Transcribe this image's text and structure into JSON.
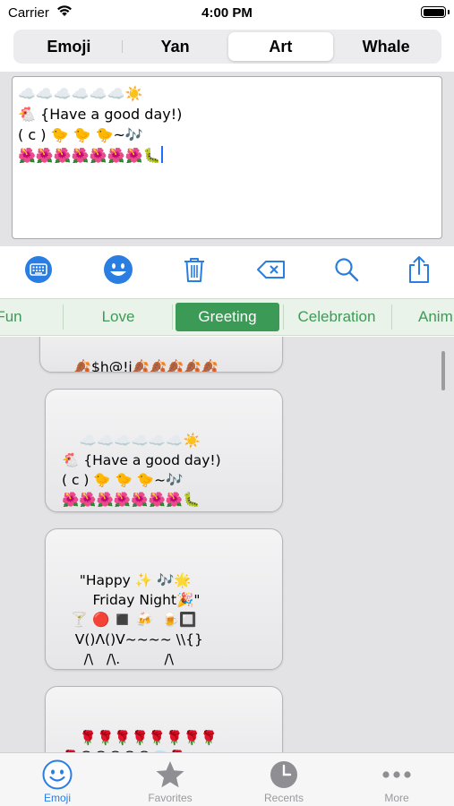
{
  "status_bar": {
    "carrier": "Carrier",
    "time": "4:00 PM"
  },
  "segments": [
    {
      "label": "Emoji"
    },
    {
      "label": "Yan"
    },
    {
      "label": "Art",
      "selected": true
    },
    {
      "label": "Whale"
    }
  ],
  "editor": {
    "text": "☁️☁️☁️☁️☁️☁️☀️\n🐔 {Have a good day!)\n( c ) 🐤 🐤 🐤~🎶\n🌺🌺🌺🌺🌺🌺🌺🐛"
  },
  "toolbar": {
    "icons": [
      "keyboard-icon",
      "smiley-icon",
      "trash-icon",
      "delete-backward-icon",
      "search-icon",
      "share-icon"
    ],
    "accent_color": "#2a7de1"
  },
  "categories": [
    {
      "label": "Fun"
    },
    {
      "label": "Love"
    },
    {
      "label": "Greeting",
      "selected": true
    },
    {
      "label": "Celebration"
    },
    {
      "label": "Anim"
    }
  ],
  "list": {
    "items": [
      {
        "text": "🍂$h@!i🍂🍂🍂🍂🍂"
      },
      {
        "text": "☁️☁️☁️☁️☁️☁️☀️\n🐔 {Have a good day!)\n( c ) 🐤 🐤 🐤~🎶\n🌺🌺🌺🌺🌺🌺🌺🐛"
      },
      {
        "text": "\"Happy ✨ 🎶🌟\n       Friday Night🎉\"\n  🍸 🔴 ◼️ 🍻  🍺🔲\n   V()Λ()V~~~~ \\\\{}\n     /\\   /\\.          /\\"
      },
      {
        "text": "🌹🌹🌹🌹🌹🌹🌹🌹\n🌹😷😢😓😷😢💎🌹\n🌹🌹🌹🌹🌹🌹🌹🌹"
      }
    ]
  },
  "tab_bar": {
    "tabs": [
      {
        "label": "Emoji",
        "icon": "smiley-face-icon",
        "selected": true
      },
      {
        "label": "Favorites",
        "icon": "star-icon"
      },
      {
        "label": "Recents",
        "icon": "clock-icon"
      },
      {
        "label": "More",
        "icon": "ellipsis-icon"
      }
    ],
    "active_color": "#2a7de1",
    "inactive_color": "#9a9a9e"
  }
}
